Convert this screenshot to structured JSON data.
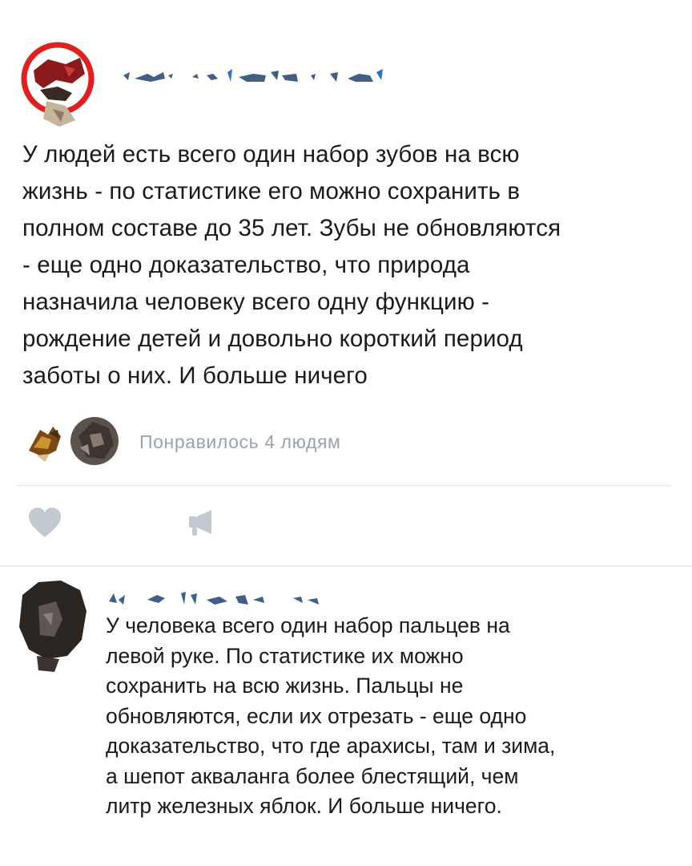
{
  "post": {
    "author_name": "",
    "text": "У людей есть всего один набор зубов на всю\nжизнь - по статистике его можно сохранить в\nполном составе до 35 лет. Зубы не обновляются\n- еще одно доказательство, что природа\nназначила человеку всего одну функцию -\nрождение детей и довольно короткий период\nзаботы о них. И больше ничего",
    "likes_text": "Понравилось 4 людям",
    "like_icon": "heart-icon",
    "share_icon": "megaphone-icon"
  },
  "comment": {
    "author_name": "",
    "text": "У человека всего один набор пальцев на\nлевой руке. По статистике их можно\nсохранить на всю жизнь. Пальцы не\nобновляются, если их отрезать - еще одно\nдоказательство, что где арахисы, там и зима,\nа шепот акваланга более блестящий, чем\nлитр железных яблок. И больше ничего."
  },
  "colors": {
    "text": "#1a1a1a",
    "muted": "#9aa3ad",
    "icon": "#c3c9d1",
    "divider": "#e3e6ea",
    "avatar_ring": "#e02020",
    "censor_blue": "#3f5f86"
  }
}
